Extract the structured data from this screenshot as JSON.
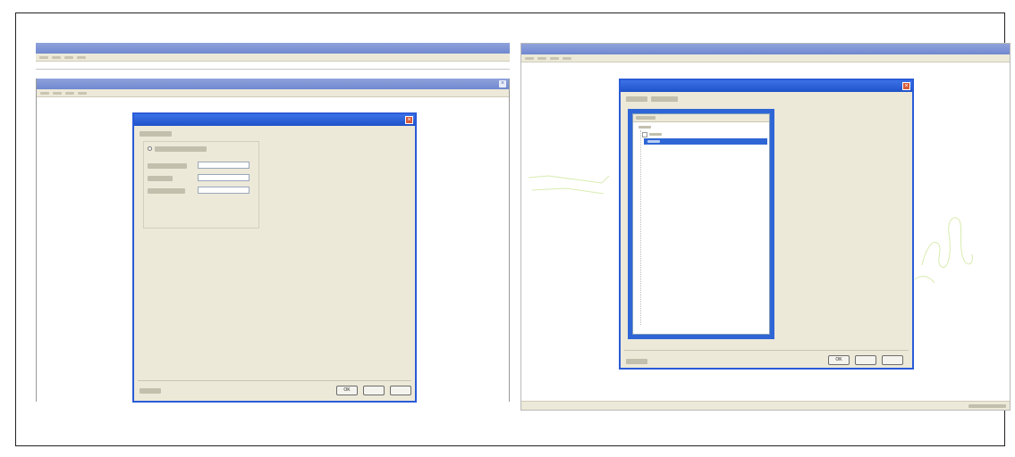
{
  "left_panel": {
    "window1": {
      "title": "",
      "menu": [
        "",
        "",
        "",
        ""
      ]
    },
    "window2": {
      "title": "",
      "menu": [
        "",
        "",
        "",
        ""
      ]
    },
    "dialog": {
      "title": "",
      "heading": "",
      "radio_label": "",
      "fields": [
        {
          "label": "",
          "value": ""
        },
        {
          "label": "",
          "value": ""
        },
        {
          "label": "",
          "value": ""
        }
      ],
      "status": "",
      "buttons": {
        "ok": "OK",
        "cancel": "",
        "apply": ""
      }
    }
  },
  "right_panel": {
    "window": {
      "title": "",
      "menu": [
        "",
        "",
        "",
        ""
      ]
    },
    "dialog": {
      "title": "",
      "path_label": "",
      "path_value": "",
      "tree": {
        "header": "",
        "items": [
          {
            "label": "",
            "selected": false
          },
          {
            "label": "",
            "selected": false
          },
          {
            "label": "",
            "selected": true
          }
        ]
      },
      "status": "",
      "buttons": {
        "ok": "OK",
        "cancel": "",
        "apply": ""
      }
    },
    "statusbar": {
      "text": ""
    }
  },
  "colors": {
    "titlebar": "#7a8fd4",
    "dialog_titlebar": "#2a5bd7",
    "dialog_bg": "#ece9d8",
    "selection": "#2f66d6",
    "sketch_line": "#cfe7a0"
  }
}
